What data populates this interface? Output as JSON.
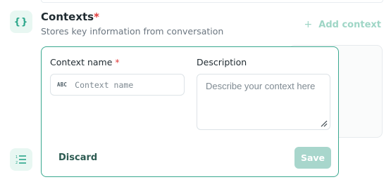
{
  "section": {
    "title": "Contexts",
    "required_marker": "*",
    "subtitle": "Stores key information from conversation",
    "add_button": {
      "icon": "plus-icon",
      "label": "Add context"
    },
    "icon": "braces-icon",
    "lower_icon": "list-icon"
  },
  "form": {
    "name_label": "Context name",
    "name_required_marker": "*",
    "name_icon_text": "ABC",
    "name_placeholder": "Context name",
    "name_value": "",
    "description_label": "Description",
    "description_placeholder": "Describe your context here",
    "description_value": "",
    "discard_label": "Discard",
    "save_label": "Save"
  },
  "colors": {
    "accent": "#3aa88f",
    "icon_bg": "#e8f7f2",
    "required": "#e03b3b",
    "save_disabled_bg": "#a8d6cc",
    "add_context_muted": "#9fd6c6"
  }
}
